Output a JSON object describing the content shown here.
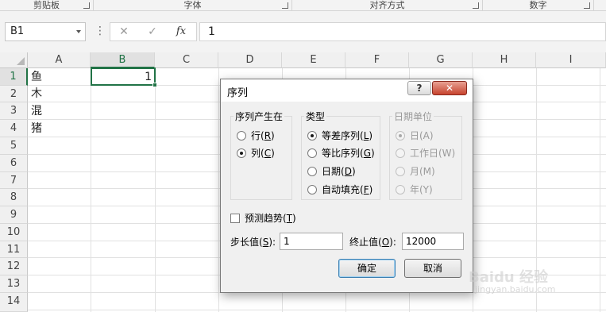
{
  "ribbon": {
    "groups": [
      "剪贴板",
      "字体",
      "对齐方式",
      "数字"
    ]
  },
  "formula_bar": {
    "name_box": "B1",
    "cancel_icon": "✕",
    "enter_icon": "✓",
    "fx_label": "fx",
    "value": "1"
  },
  "grid": {
    "columns": [
      "A",
      "B",
      "C",
      "D",
      "E",
      "F",
      "G",
      "H",
      "I"
    ],
    "rows": [
      "1",
      "2",
      "3",
      "4",
      "5",
      "6",
      "7",
      "8",
      "9",
      "10",
      "11",
      "12",
      "13",
      "14"
    ],
    "selected_cell": "B1",
    "cells": {
      "A1": "鱼",
      "A2": "木",
      "A3": "混",
      "A4": "猪",
      "B1": "1"
    }
  },
  "dialog": {
    "title": "序列",
    "help_label": "?",
    "close_label": "✕",
    "series_in": {
      "title": "序列产生在",
      "options": [
        {
          "label": "行(R)",
          "main": "行(",
          "key": "R",
          "tail": ")",
          "selected": false
        },
        {
          "label": "列(C)",
          "main": "列(",
          "key": "C",
          "tail": ")",
          "selected": true
        }
      ]
    },
    "type": {
      "title": "类型",
      "options": [
        {
          "main": "等差序列(",
          "key": "L",
          "tail": ")",
          "selected": true
        },
        {
          "main": "等比序列(",
          "key": "G",
          "tail": ")",
          "selected": false
        },
        {
          "main": "日期(",
          "key": "D",
          "tail": ")",
          "selected": false
        },
        {
          "main": "自动填充(",
          "key": "F",
          "tail": ")",
          "selected": false
        }
      ]
    },
    "date_unit": {
      "title": "日期单位",
      "disabled": true,
      "options": [
        {
          "label": "日(A)",
          "selected": true
        },
        {
          "label": "工作日(W)",
          "selected": false
        },
        {
          "label": "月(M)",
          "selected": false
        },
        {
          "label": "年(Y)",
          "selected": false
        }
      ]
    },
    "trend": {
      "main": "预测趋势(",
      "key": "T",
      "tail": ")",
      "checked": false
    },
    "step": {
      "main": "步长值(",
      "key": "S",
      "tail": "):",
      "value": "1"
    },
    "stop": {
      "main": "终止值(",
      "key": "O",
      "tail": "):",
      "value": "12000"
    },
    "ok_label": "确定",
    "cancel_label": "取消"
  },
  "watermark": {
    "text": "Baidu 经验",
    "sub": "jingyan.baidu.com"
  }
}
